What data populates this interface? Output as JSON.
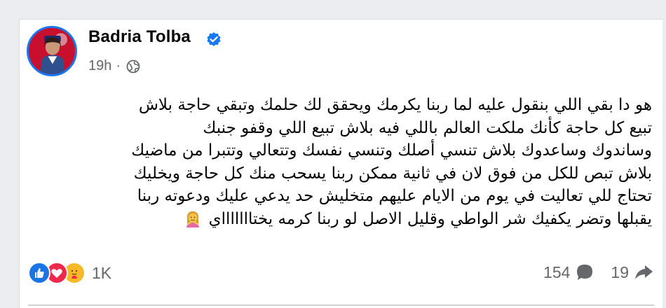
{
  "post": {
    "author": "Badria Tolba",
    "verified": true,
    "time": "19h",
    "separator": "·",
    "audience_icon": "globe-icon",
    "text_lines": [
      "هو دا بقي اللي بنقول عليه لما ربنا يكرمك ويحقق لك حلمك وتبقي حاجة بلاش",
      "تبيع كل حاجة كأنك ملكت العالم باللي فيه بلاش تبيع  اللي وقفو جنبك",
      "وساندوك وساعدوك بلاش تنسي أصلك وتنسي نفسك وتتعالي وتتبرا من ماضيك",
      "بلاش تبص للكل من فوق لان في ثانية ممكن ربنا يسحب منك كل حاجة ويخليك",
      "تحتاج للي تعاليت في يوم من الايام عليهم متخليش حد يدعي عليك ودعوته ربنا",
      "يقبلها وتضر يكفيك شر الواطي وقليل الاصل لو ربنا كرمه يختاااااااي"
    ],
    "text_emoji": "woman-gesturing-emoji"
  },
  "reactions": {
    "icons": [
      "like-icon",
      "love-icon",
      "care-icon"
    ],
    "count": "1K"
  },
  "stats": {
    "comments": "154",
    "shares": "19"
  },
  "colors": {
    "brand_blue": "#1877f2",
    "love_red": "#f0284a",
    "care_yellow": "#f7b928",
    "secondary_text": "#65676b"
  }
}
